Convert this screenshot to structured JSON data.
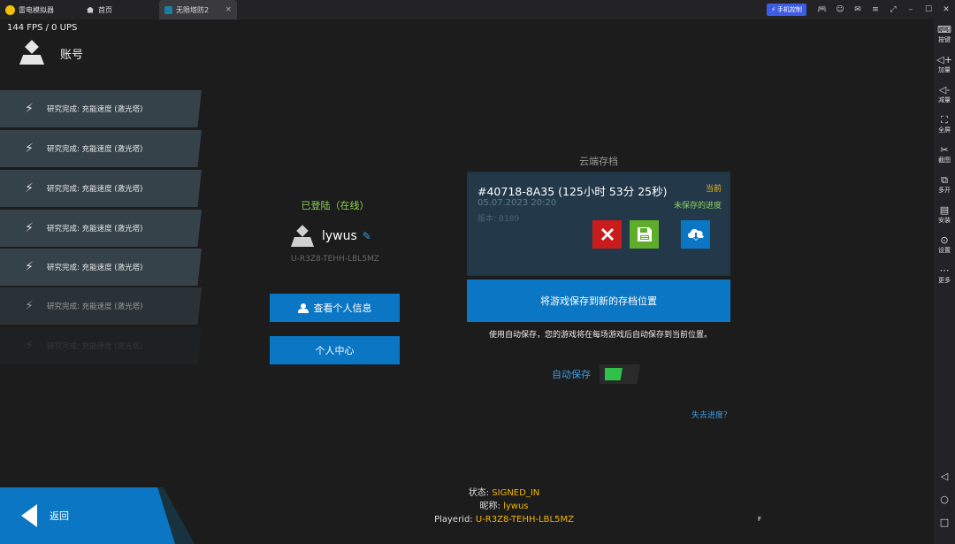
{
  "titlebar": {
    "app_name": "雷电模拟器",
    "tab_home": "首页",
    "tab_game": "无限塔防2",
    "tab_close": "×",
    "phone_control": "手机控制",
    "icons": [
      "gamepad-icon",
      "user-icon",
      "mail-icon",
      "menu-icon",
      "restore-icon",
      "minimize-icon",
      "maximize-icon",
      "close-icon"
    ]
  },
  "sidebar": {
    "items": [
      {
        "label": "按键",
        "icon": "keyboard-icon",
        "glyph": "⌨"
      },
      {
        "label": "加量",
        "icon": "volume-up-icon",
        "glyph": "🔈"
      },
      {
        "label": "减量",
        "icon": "volume-down-icon",
        "glyph": "🔉"
      },
      {
        "label": "全屏",
        "icon": "fullscreen-icon",
        "glyph": "⛶"
      },
      {
        "label": "截图",
        "icon": "scissors-icon",
        "glyph": "✂"
      },
      {
        "label": "多开",
        "icon": "multi-instance-icon",
        "glyph": "⧉"
      },
      {
        "label": "安装",
        "icon": "install-icon",
        "glyph": "▤"
      },
      {
        "label": "设置",
        "icon": "settings-icon",
        "glyph": "⚙"
      },
      {
        "label": "更多",
        "icon": "more-icon",
        "glyph": "⋯"
      }
    ],
    "nav": {
      "back": "◁",
      "home": "○",
      "recent": "□"
    }
  },
  "game": {
    "fps": "144 FPS / 0 UPS",
    "account_title": "账号",
    "notifications": [
      "研究完成: 充能速度 (激光塔)",
      "研究完成: 充能速度 (激光塔)",
      "研究完成: 充能速度 (激光塔)",
      "研究完成: 充能速度 (激光塔)",
      "研究完成: 充能速度 (激光塔)",
      "研究完成: 充能速度 (激光塔)",
      "研究完成: 充能速度 (激光塔)"
    ],
    "login_status": "已登陆（在线）",
    "username": "lywus",
    "user_id": "U-R3Z8-TEHH-LBL5MZ",
    "btn_profile": "查看个人信息",
    "btn_center": "个人中心",
    "cloud": {
      "title": "云端存档",
      "save_id": "#40718-8A35 (125小时 53分 25秒)",
      "current": "当前",
      "date": "05.07.2023 20:20",
      "unsaved": "未保存的进度",
      "version": "版本: B189",
      "btn_save_new": "将游戏保存到新的存档位置",
      "autosave_desc": "使用自动保存，您的游戏将在每场游戏后自动保存到当前位置。",
      "autosave_label": "自动保存",
      "autosave_on": true,
      "lost_progress": "失去进度？"
    },
    "back_label": "返回",
    "status": {
      "state_label": "状态:",
      "state_value": "SIGNED_IN",
      "nick_label": "昵称:",
      "nick_value": "lywus",
      "pid_label": "Playerid:",
      "pid_value": "U-R3Z8-TEHH-LBL5MZ"
    },
    "tiny_f": "F"
  },
  "colors": {
    "accent_blue": "#0b76c4",
    "online_green": "#8dd25a",
    "current_orange": "#f2b600",
    "delete_red": "#c91c1c",
    "save_green": "#5fae2b"
  }
}
